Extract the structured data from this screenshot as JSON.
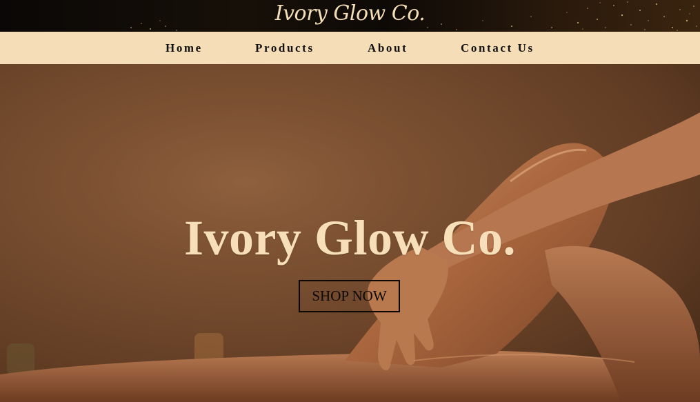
{
  "header": {
    "brand": "Ivory Glow Co."
  },
  "nav": {
    "items": [
      {
        "label": "Home"
      },
      {
        "label": "Products"
      },
      {
        "label": "About"
      },
      {
        "label": "Contact Us"
      }
    ]
  },
  "hero": {
    "title": "Ivory Glow Co.",
    "cta_label": "SHOP NOW"
  },
  "colors": {
    "brand_cream": "#f5ddb8",
    "header_dark": "#0a0706",
    "hero_brown": "#7a4f31",
    "text_dark": "#111111"
  }
}
